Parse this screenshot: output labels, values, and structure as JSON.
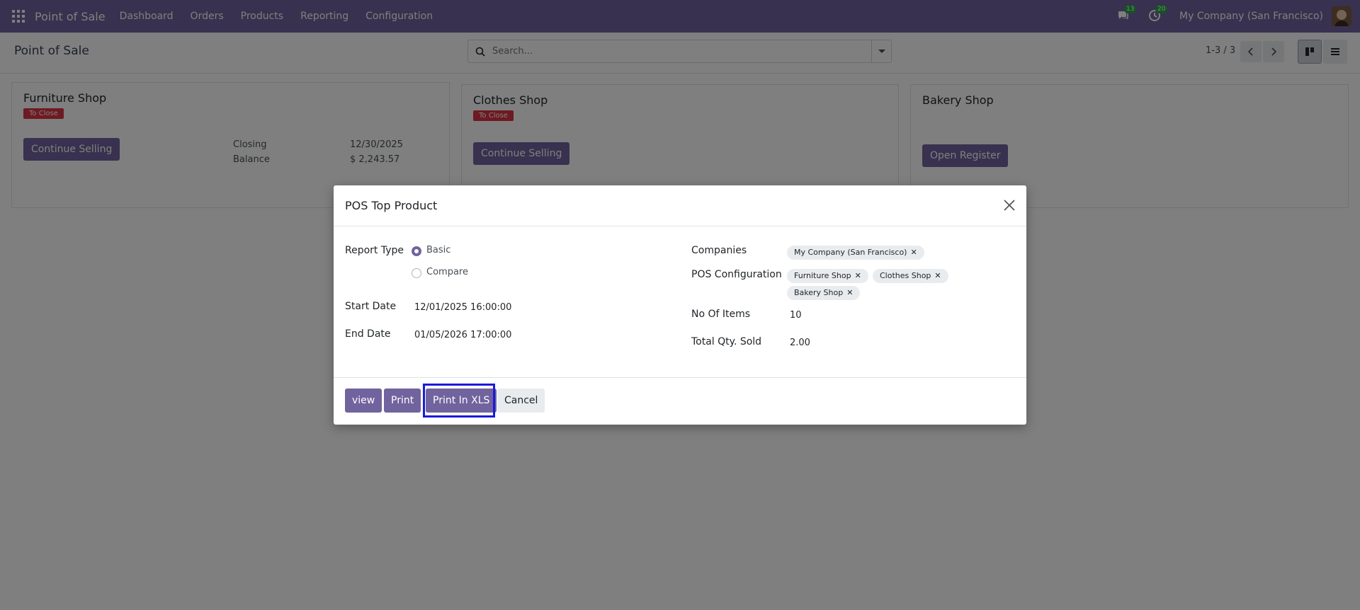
{
  "navbar": {
    "app_name": "Point of Sale",
    "menu": [
      "Dashboard",
      "Orders",
      "Products",
      "Reporting",
      "Configuration"
    ],
    "messages_count": "13",
    "activities_count": "20",
    "company": "My Company (San Francisco)",
    "accent_color": "#71639e"
  },
  "control_panel": {
    "breadcrumb": "Point of Sale",
    "search_placeholder": "Search...",
    "pager": "1-3 / 3"
  },
  "cards": [
    {
      "title": "Furniture Shop",
      "badge": "To Close",
      "button": "Continue Selling",
      "closing_label": "Closing",
      "closing_value": "12/30/2025",
      "balance_label": "Balance",
      "balance_value": "$ 2,243.57"
    },
    {
      "title": "Clothes Shop",
      "badge": "To Close",
      "button": "Continue Selling"
    },
    {
      "title": "Bakery Shop",
      "button": "Open Register"
    }
  ],
  "modal": {
    "title": "POS Top Product",
    "report_type_label": "Report Type",
    "report_type_options": [
      "Basic",
      "Compare"
    ],
    "report_type_selected": "Basic",
    "start_date_label": "Start Date",
    "start_date_value": "12/01/2025 16:00:00",
    "end_date_label": "End Date",
    "end_date_value": "01/05/2026 17:00:00",
    "companies_label": "Companies",
    "companies": [
      "My Company (San Francisco)"
    ],
    "pos_config_label": "POS Configuration",
    "pos_configs": [
      "Furniture Shop",
      "Clothes Shop",
      "Bakery Shop"
    ],
    "no_items_label": "No Of Items",
    "no_items_value": "10",
    "total_qty_label": "Total Qty. Sold",
    "total_qty_value": "2.00",
    "buttons": {
      "view": "view",
      "print": "Print",
      "print_xls": "Print In XLS",
      "cancel": "Cancel"
    }
  }
}
